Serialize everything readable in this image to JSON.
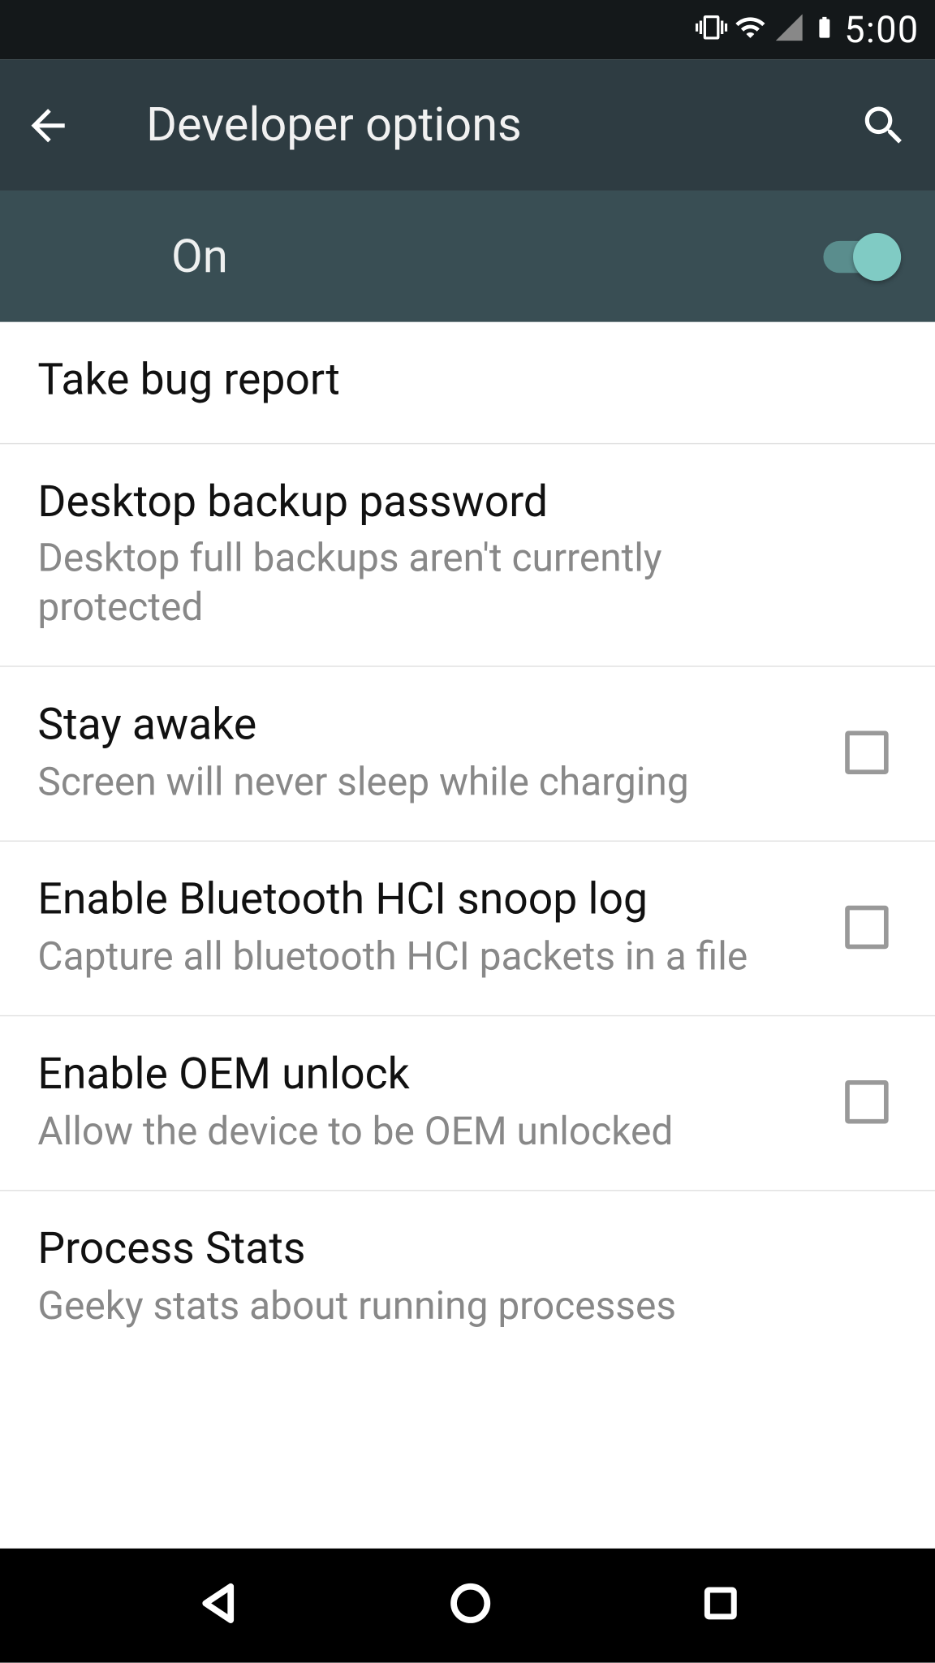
{
  "statusbar": {
    "time": "5:00"
  },
  "appbar": {
    "title": "Developer options"
  },
  "toggle": {
    "label": "On",
    "state": true
  },
  "settings": [
    {
      "key": "take_bug_report",
      "title": "Take bug report",
      "sub": null,
      "checkbox": false
    },
    {
      "key": "desktop_backup_password",
      "title": "Desktop backup password",
      "sub": "Desktop full backups aren't currently protected",
      "checkbox": false
    },
    {
      "key": "stay_awake",
      "title": "Stay awake",
      "sub": "Screen will never sleep while charging",
      "checkbox": true,
      "checked": false
    },
    {
      "key": "enable_bluetooth_hci",
      "title": "Enable Bluetooth HCI snoop log",
      "sub": "Capture all bluetooth HCI packets in a file",
      "checkbox": true,
      "checked": false
    },
    {
      "key": "enable_oem_unlock",
      "title": "Enable OEM unlock",
      "sub": "Allow the device to be OEM unlocked",
      "checkbox": true,
      "checked": false
    },
    {
      "key": "process_stats",
      "title": "Process Stats",
      "sub": "Geeky stats about running processes",
      "checkbox": false
    }
  ]
}
